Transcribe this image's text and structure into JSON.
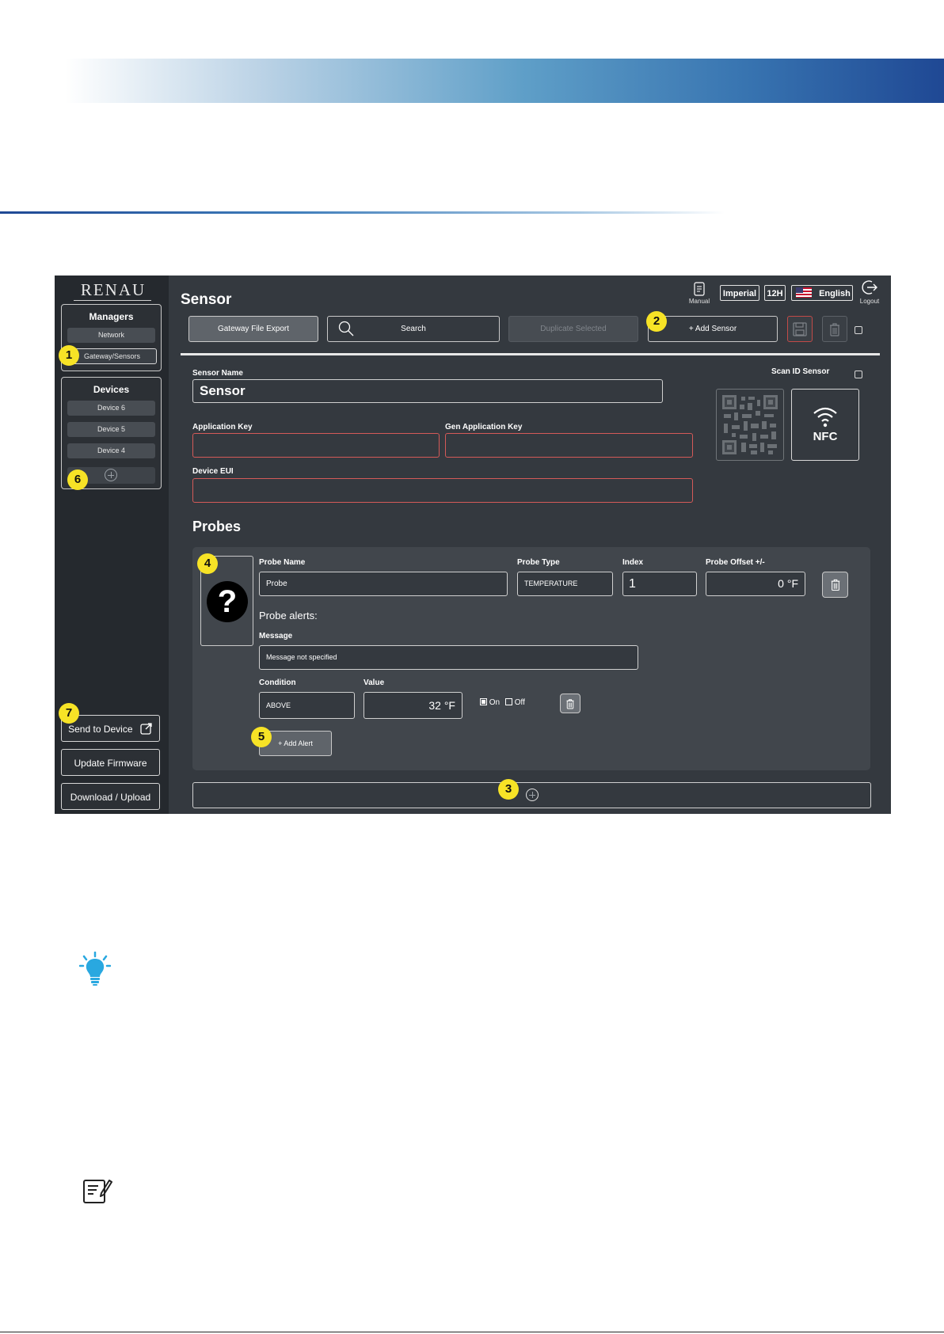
{
  "app": {
    "logo": "RENAU",
    "page_title": "Sensor",
    "top_bar": {
      "manual_label": "Manual",
      "units": "Imperial",
      "time_format": "12H",
      "language": "English",
      "logout_label": "Logout"
    },
    "toolbar": {
      "gateway_export": "Gateway File Export",
      "search": "Search",
      "duplicate": "Duplicate Selected",
      "add_sensor": "+ Add Sensor"
    },
    "sidebar": {
      "managers_title": "Managers",
      "managers": [
        "Network",
        "Gateway/Sensors"
      ],
      "devices_title": "Devices",
      "devices": [
        "Device 6",
        "Device 5",
        "Device 4"
      ],
      "send_to_device": "Send to Device",
      "update_firmware": "Update Firmware",
      "download_upload": "Download / Upload"
    },
    "sensor_form": {
      "sensor_name_label": "Sensor Name",
      "sensor_name_value": "Sensor",
      "scan_id_label": "Scan ID Sensor",
      "application_key_label": "Application Key",
      "application_key_value": "",
      "gen_application_key_label": "Gen Application Key",
      "gen_application_key_value": "",
      "device_eui_label": "Device EUI",
      "device_eui_value": "",
      "nfc_label": "NFC"
    },
    "probes": {
      "title": "Probes",
      "probe_name_label": "Probe Name",
      "probe_name_value": "Probe",
      "probe_type_label": "Probe Type",
      "probe_type_value": "TEMPERATURE",
      "index_label": "Index",
      "index_value": "1",
      "offset_label": "Probe Offset +/-",
      "offset_value": "0 °F",
      "alerts_title": "Probe alerts:",
      "message_label": "Message",
      "message_value": "Message not specified",
      "condition_label": "Condition",
      "condition_value": "ABOVE",
      "value_label": "Value",
      "value_value": "32 °F",
      "on_label": "On",
      "off_label": "Off",
      "add_alert": "+ Add Alert"
    }
  },
  "callouts": [
    "1",
    "2",
    "3",
    "4",
    "5",
    "6",
    "7"
  ],
  "colors": {
    "app_bg": "#34393f",
    "sidebar_bg": "#25292e",
    "badge": "#f7e326",
    "invalid_border": "#d45a58",
    "brand_blue": "#1f4894",
    "tip_icon": "#29a8e0"
  }
}
